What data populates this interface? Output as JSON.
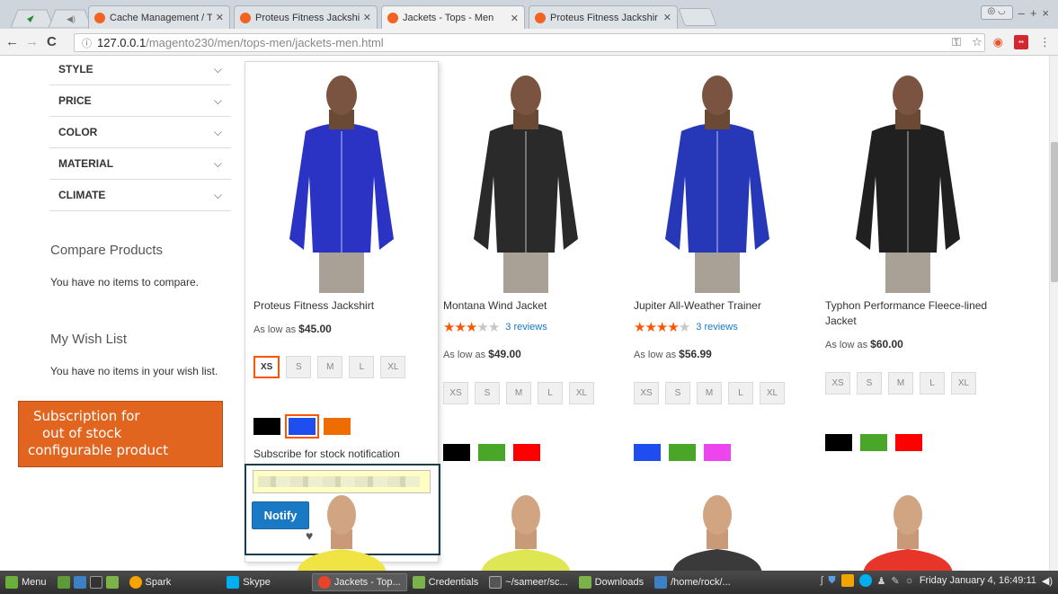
{
  "browser": {
    "tabs": [
      {
        "label": "Cache Management / T",
        "active": false
      },
      {
        "label": "Proteus Fitness Jackshir",
        "active": false
      },
      {
        "label": "Jackets - Tops - Men",
        "active": true
      },
      {
        "label": "Proteus Fitness Jackshir",
        "active": false
      }
    ],
    "url_host": "127.0.0.1",
    "url_path": "/magento230/men/tops-men/jackets-men.html"
  },
  "sidebar": {
    "filters": [
      "STYLE",
      "PRICE",
      "COLOR",
      "MATERIAL",
      "CLIMATE"
    ],
    "compare_title": "Compare Products",
    "compare_text": "You have no items to compare.",
    "wishlist_title": "My Wish List",
    "wishlist_text": "You have no items in your wish list."
  },
  "callout": {
    "lines": [
      "Subscription for",
      "out of stock",
      "configurable product"
    ]
  },
  "products": [
    {
      "name": "Proteus Fitness Jackshirt",
      "price_prefix": "As low as",
      "price": "$45.00",
      "sizes": [
        "XS",
        "S",
        "M",
        "L",
        "XL"
      ],
      "selected_size": "XS",
      "colors": [
        "#000000",
        "#1f4ef0",
        "#ef6c00"
      ],
      "selected_color": 1,
      "jacket_color": "#2a33c4"
    },
    {
      "name": "Montana Wind Jacket",
      "rating": 3,
      "reviews": "3 reviews",
      "price_prefix": "As low as",
      "price": "$49.00",
      "sizes": [
        "XS",
        "S",
        "M",
        "L",
        "XL"
      ],
      "colors": [
        "#000000",
        "#49a629",
        "#ff0000"
      ],
      "jacket_color": "#2a2a2a"
    },
    {
      "name": "Jupiter All-Weather Trainer",
      "rating": 4,
      "reviews": "3 reviews",
      "price_prefix": "As low as",
      "price": "$56.99",
      "sizes": [
        "XS",
        "S",
        "M",
        "L",
        "XL"
      ],
      "colors": [
        "#1f4ef0",
        "#49a629",
        "#ee44ee"
      ],
      "jacket_color": "#2638b8"
    },
    {
      "name": "Typhon Performance Fleece-lined Jacket",
      "price_prefix": "As low as",
      "price": "$60.00",
      "sizes": [
        "XS",
        "S",
        "M",
        "L",
        "XL"
      ],
      "colors": [
        "#000000",
        "#49a629",
        "#ff0000"
      ],
      "jacket_color": "#202020"
    }
  ],
  "stock_alert": {
    "label": "Subscribe for stock notification",
    "email_value": "",
    "button": "Notify"
  },
  "next_row_colors": [
    "#f0e445",
    "#dfe653",
    "#3a3a3a",
    "#e8352a"
  ],
  "taskbar": {
    "items": [
      "Menu",
      "Spark",
      "Skype",
      "Jackets - Top...",
      "Credentials",
      "~/sameer/sc...",
      "Downloads",
      "/home/rock/..."
    ],
    "clock": "Friday January  4, 16:49:11"
  }
}
